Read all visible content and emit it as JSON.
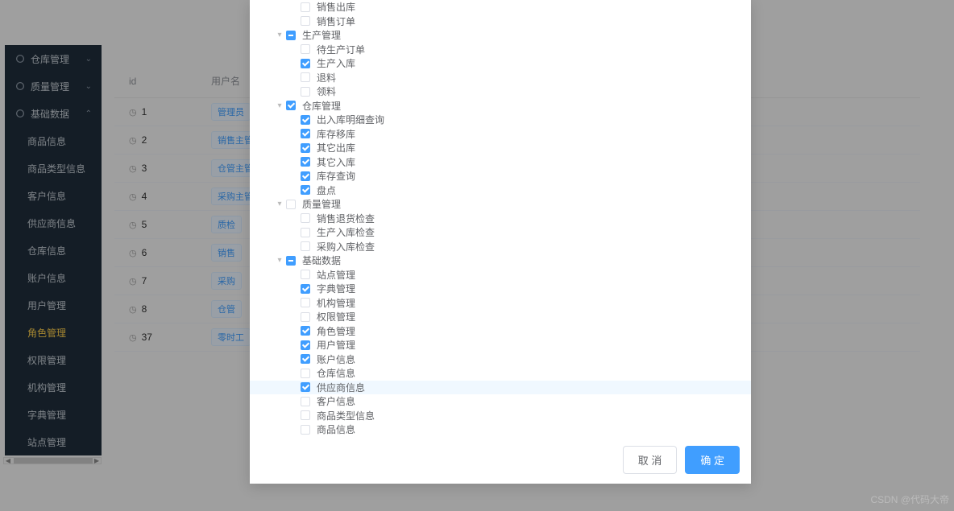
{
  "sidebar": {
    "groups": [
      {
        "label": "仓库管理",
        "icon": "cube-icon",
        "expandable": true
      },
      {
        "label": "质量管理",
        "icon": "user-icon",
        "expandable": true
      },
      {
        "label": "基础数据",
        "icon": "compass-icon",
        "expandable": true,
        "expanded": true
      }
    ],
    "children": [
      {
        "label": "商品信息"
      },
      {
        "label": "商品类型信息"
      },
      {
        "label": "客户信息"
      },
      {
        "label": "供应商信息"
      },
      {
        "label": "仓库信息"
      },
      {
        "label": "账户信息"
      },
      {
        "label": "用户管理"
      },
      {
        "label": "角色管理",
        "active": true
      },
      {
        "label": "权限管理"
      },
      {
        "label": "机构管理"
      },
      {
        "label": "字典管理"
      },
      {
        "label": "站点管理"
      }
    ]
  },
  "table": {
    "headers": {
      "id": "id",
      "user": "用户名"
    },
    "rows": [
      {
        "id": "1",
        "tag": "管理员"
      },
      {
        "id": "2",
        "tag": "销售主管"
      },
      {
        "id": "3",
        "tag": "仓管主管"
      },
      {
        "id": "4",
        "tag": "采购主管"
      },
      {
        "id": "5",
        "tag": "质检"
      },
      {
        "id": "6",
        "tag": "销售"
      },
      {
        "id": "7",
        "tag": "采购"
      },
      {
        "id": "8",
        "tag": "仓管"
      },
      {
        "id": "37",
        "tag": "零时工"
      }
    ]
  },
  "tree": [
    {
      "depth": 2,
      "label": "销售出库",
      "checked": false
    },
    {
      "depth": 2,
      "label": "销售订单",
      "checked": false
    },
    {
      "depth": 1,
      "label": "生产管理",
      "checked": "indeterminate",
      "expander": "down"
    },
    {
      "depth": 2,
      "label": "待生产订单",
      "checked": false
    },
    {
      "depth": 2,
      "label": "生产入库",
      "checked": true
    },
    {
      "depth": 2,
      "label": "退料",
      "checked": false
    },
    {
      "depth": 2,
      "label": "领料",
      "checked": false
    },
    {
      "depth": 1,
      "label": "仓库管理",
      "checked": true,
      "expander": "down"
    },
    {
      "depth": 2,
      "label": "出入库明细查询",
      "checked": true
    },
    {
      "depth": 2,
      "label": "库存移库",
      "checked": true
    },
    {
      "depth": 2,
      "label": "其它出库",
      "checked": true
    },
    {
      "depth": 2,
      "label": "其它入库",
      "checked": true
    },
    {
      "depth": 2,
      "label": "库存查询",
      "checked": true
    },
    {
      "depth": 2,
      "label": "盘点",
      "checked": true
    },
    {
      "depth": 1,
      "label": "质量管理",
      "checked": false,
      "expander": "down"
    },
    {
      "depth": 2,
      "label": "销售退货检查",
      "checked": false
    },
    {
      "depth": 2,
      "label": "生产入库检查",
      "checked": false
    },
    {
      "depth": 2,
      "label": "采购入库检查",
      "checked": false
    },
    {
      "depth": 1,
      "label": "基础数据",
      "checked": "indeterminate",
      "expander": "down"
    },
    {
      "depth": 2,
      "label": "站点管理",
      "checked": false
    },
    {
      "depth": 2,
      "label": "字典管理",
      "checked": true
    },
    {
      "depth": 2,
      "label": "机构管理",
      "checked": false
    },
    {
      "depth": 2,
      "label": "权限管理",
      "checked": false
    },
    {
      "depth": 2,
      "label": "角色管理",
      "checked": true
    },
    {
      "depth": 2,
      "label": "用户管理",
      "checked": true
    },
    {
      "depth": 2,
      "label": "账户信息",
      "checked": true
    },
    {
      "depth": 2,
      "label": "仓库信息",
      "checked": false
    },
    {
      "depth": 2,
      "label": "供应商信息",
      "checked": true,
      "hovered": true
    },
    {
      "depth": 2,
      "label": "客户信息",
      "checked": false
    },
    {
      "depth": 2,
      "label": "商品类型信息",
      "checked": false
    },
    {
      "depth": 2,
      "label": "商品信息",
      "checked": false
    }
  ],
  "modal_buttons": {
    "cancel": "取 消",
    "confirm": "确 定"
  },
  "watermark": "CSDN @代码大帝"
}
